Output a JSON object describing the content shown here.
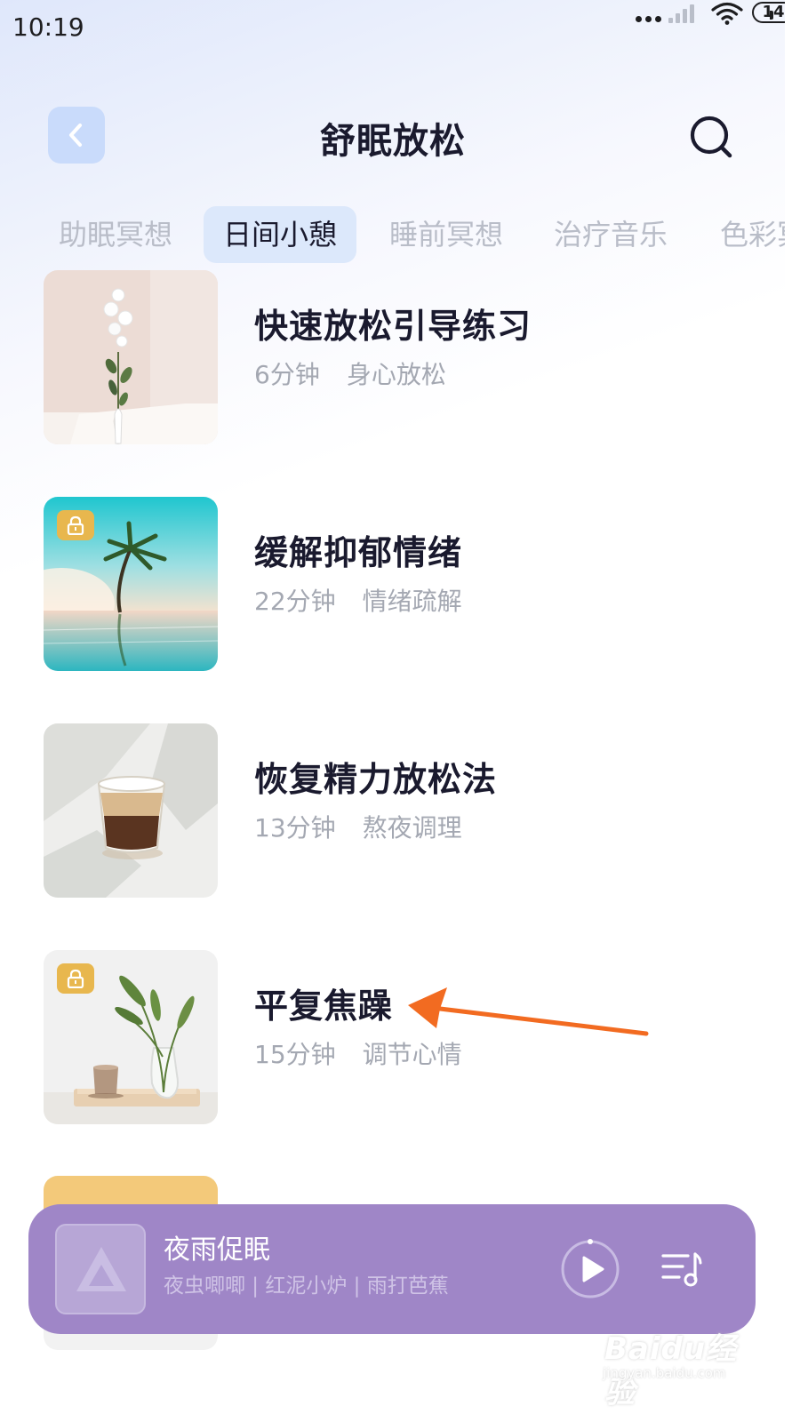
{
  "status_bar": {
    "time": "10:19",
    "battery": "14",
    "icons": [
      "more-dots-icon",
      "cellular-signal-icon",
      "wifi-icon",
      "battery-icon"
    ]
  },
  "header": {
    "title": "舒眠放松",
    "back_icon": "chevron-left-icon",
    "search_icon": "search-icon"
  },
  "tabs": [
    {
      "label": "助眠冥想",
      "active": false
    },
    {
      "label": "日间小憩",
      "active": true
    },
    {
      "label": "睡前冥想",
      "active": false
    },
    {
      "label": "治疗音乐",
      "active": false
    },
    {
      "label": "色彩冥想",
      "active": false
    }
  ],
  "list": [
    {
      "title": "快速放松引导练习",
      "duration": "6分钟",
      "tag": "身心放松",
      "locked": false
    },
    {
      "title": "缓解抑郁情绪",
      "duration": "22分钟",
      "tag": "情绪疏解",
      "locked": true
    },
    {
      "title": "恢复精力放松法",
      "duration": "13分钟",
      "tag": "熬夜调理",
      "locked": false
    },
    {
      "title": "平复焦躁",
      "duration": "15分钟",
      "tag": "调节心情",
      "locked": true
    }
  ],
  "player": {
    "title": "夜雨促眠",
    "subtitle": "夜虫唧唧 | 红泥小炉 | 雨打芭蕉",
    "play_icon": "play-icon",
    "playlist_icon": "playlist-icon"
  },
  "watermark": {
    "brand": "Baidu经验",
    "url": "jingyan.baidu.com"
  },
  "colors": {
    "accent": "#dce8fb",
    "title_text": "#1a1a2e",
    "muted_text": "#a4a8b2",
    "player_bg": "#9f86c7",
    "lock_badge": "#e8b74e",
    "annotation_arrow": "#f26b21"
  }
}
